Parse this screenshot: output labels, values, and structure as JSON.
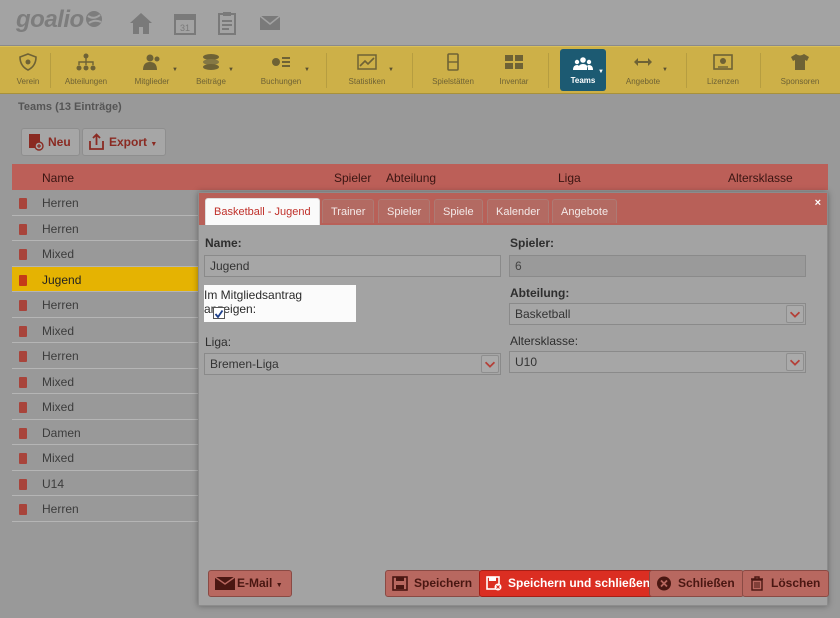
{
  "app": {
    "logo": "goalio"
  },
  "nav": [
    {
      "label": "Verein",
      "icon": "shield-icon"
    },
    {
      "label": "Abteilungen",
      "icon": "org-chart-icon"
    },
    {
      "label": "Mitglieder",
      "icon": "members-icon"
    },
    {
      "label": "Beiträge",
      "icon": "coins-icon"
    },
    {
      "label": "Buchungen",
      "icon": "bookings-icon"
    },
    {
      "label": "Statistiken",
      "icon": "chart-icon"
    },
    {
      "label": "Spielstätten",
      "icon": "venue-icon"
    },
    {
      "label": "Inventar",
      "icon": "inventory-icon"
    },
    {
      "label": "Teams",
      "icon": "teams-icon"
    },
    {
      "label": "Angebote",
      "icon": "arrows-icon"
    },
    {
      "label": "Lizenzen",
      "icon": "license-icon"
    },
    {
      "label": "Sponsoren",
      "icon": "shirt-icon"
    }
  ],
  "page": {
    "title": "Teams (13 Einträge)"
  },
  "toolbar": {
    "new_label": "Neu",
    "export_label": "Export"
  },
  "table": {
    "columns": [
      "Name",
      "Spieler",
      "Abteilung",
      "Liga",
      "Altersklasse"
    ],
    "rows": [
      "Herren",
      "Herren",
      "Mixed",
      "Jugend",
      "Herren",
      "Mixed",
      "Herren",
      "Mixed",
      "Mixed",
      "Damen",
      "Mixed",
      "U14",
      "Herren"
    ],
    "selected_index": 3
  },
  "dialog": {
    "tabs": [
      "Basketball - Jugend",
      "Trainer",
      "Spieler",
      "Spiele",
      "Kalender",
      "Angebote"
    ],
    "close": "×",
    "name_label": "Name:",
    "name_value": "Jugend",
    "spieler_label": "Spieler:",
    "spieler_value": "6",
    "antrag_label": "Im Mitgliedsantrag anzeigen:",
    "antrag_checked": true,
    "abteilung_label": "Abteilung:",
    "abteilung_value": "Basketball",
    "liga_label": "Liga:",
    "liga_value": "Bremen-Liga",
    "altersklasse_label": "Altersklasse:",
    "altersklasse_value": "U10",
    "buttons": {
      "email": "E-Mail",
      "save": "Speichern",
      "save_close": "Speichern und schließen",
      "close": "Schließen",
      "delete": "Löschen"
    }
  },
  "colors": {
    "accent": "#cdb048",
    "header": "#bc5f58",
    "selected": "#e5b302",
    "primary_button": "#db2e22",
    "active_nav": "#1c5a72"
  }
}
